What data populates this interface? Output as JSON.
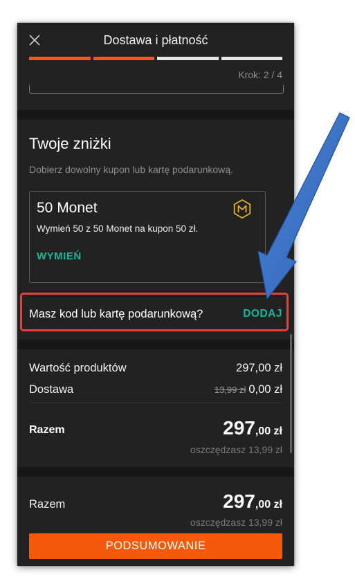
{
  "header": {
    "title": "Dostawa i płatność",
    "close_icon": "close-icon",
    "progress_total": 4,
    "progress_current": 2,
    "step_text": "Krok: 2 / 4"
  },
  "discounts": {
    "title": "Twoje zniżki",
    "subtitle": "Dobierz dowolny kupon lub kartę podarunkową.",
    "monet_card": {
      "title": "50 Monet",
      "description": "Wymień 50 z 50 Monet na kupon 50 zł.",
      "button_label": "WYMIEŃ",
      "icon": "monet-coin-icon"
    },
    "code_question": "Masz kod lub kartę podarunkową?",
    "code_add_label": "DODAJ"
  },
  "summary": {
    "products_label": "Wartość produktów",
    "products_value": "297,00 zł",
    "shipping_label": "Dostawa",
    "shipping_old": "13,99 zł",
    "shipping_value": "0,00 zł",
    "total_label": "Razem",
    "total_main": "297",
    "total_decimal": ",00 zł",
    "savings_text": "oszczędzasz 13,99 zł"
  },
  "footer": {
    "total_label": "Razem",
    "total_main": "297",
    "total_decimal": ",00 zł",
    "savings_text": "oszczędzasz 13,99 zł",
    "cta_label": "PODSUMOWANIE"
  },
  "colors": {
    "accent_orange": "#f55a0c",
    "accent_teal": "#1fb59c",
    "highlight_red": "#e8403c",
    "annotation_arrow_blue": "#3b72c4",
    "monet_gold": "#e0b22a"
  }
}
